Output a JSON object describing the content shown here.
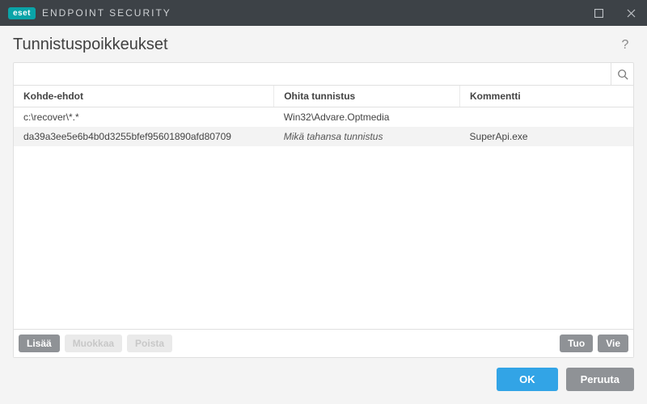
{
  "brand": {
    "badge": "eset",
    "name": "ENDPOINT SECURITY"
  },
  "page": {
    "title": "Tunnistuspoikkeukset"
  },
  "search": {
    "value": "",
    "placeholder": ""
  },
  "table": {
    "columns": [
      "Kohde-ehdot",
      "Ohita tunnistus",
      "Kommentti"
    ],
    "rows": [
      {
        "target": "c:\\recover\\*.*",
        "detection": "Win32\\Advare.Optmedia",
        "detection_italic": false,
        "comment": ""
      },
      {
        "target": "da39a3ee5e6b4b0d3255bfef95601890afd80709",
        "detection": "Mikä tahansa tunnistus",
        "detection_italic": true,
        "comment": "SuperApi.exe"
      }
    ]
  },
  "panel_buttons": {
    "add": "Lisää",
    "edit": "Muokkaa",
    "delete": "Poista",
    "import": "Tuo",
    "export": "Vie"
  },
  "dialog_buttons": {
    "ok": "OK",
    "cancel": "Peruuta"
  }
}
